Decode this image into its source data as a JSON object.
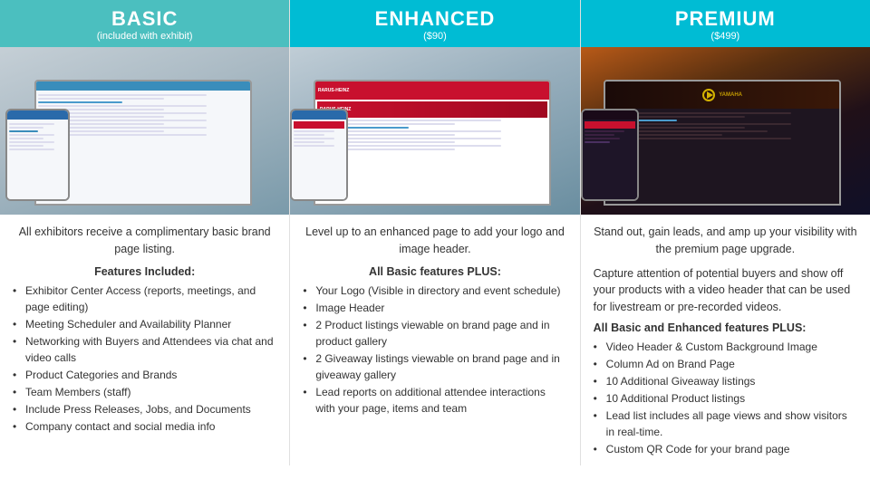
{
  "columns": [
    {
      "id": "basic",
      "badge_class": "basic",
      "title": "BASIC",
      "subtitle": "(included with exhibit)",
      "intro": "All exhibitors receive a complimentary basic brand page listing.",
      "features_title": "Features Included:",
      "features": [
        "Exhibitor Center Access (reports, meetings, and page editing)",
        "Meeting Scheduler and Availability Planner",
        "Networking with Buyers and Attendees via chat and video calls",
        "Product Categories and Brands",
        "Team Members (staff)",
        "Include Press Releases, Jobs, and Documents",
        "Company contact and social media info"
      ]
    },
    {
      "id": "enhanced",
      "badge_class": "enhanced",
      "title": "ENHANCED",
      "subtitle": "($90)",
      "intro": "Level up to an enhanced page to add your logo and image header.",
      "features_title": "All Basic features PLUS:",
      "features": [
        "Your Logo (Visible in directory and event schedule)",
        "Image Header",
        "2 Product listings viewable on brand page and in product gallery",
        "2 Giveaway listings viewable on brand page and in giveaway gallery",
        "Lead reports on additional attendee interactions with your page, items and team"
      ]
    },
    {
      "id": "premium",
      "badge_class": "premium",
      "title": "PREMIUM",
      "subtitle": "($499)",
      "intro": "Stand out, gain leads, and amp up your visibility with the premium page upgrade.",
      "intro2": "Capture attention of potential buyers and show off your products with a video header that can be used for livestream or pre-recorded videos.",
      "features_title": "All Basic and Enhanced features PLUS:",
      "features": [
        "Video Header & Custom Background Image",
        "Column Ad on Brand Page",
        "10 Additional Giveaway listings",
        "10 Additional Product listings",
        "Lead list includes all page views and show visitors in real-time.",
        "Custom QR Code for your brand page"
      ]
    }
  ]
}
